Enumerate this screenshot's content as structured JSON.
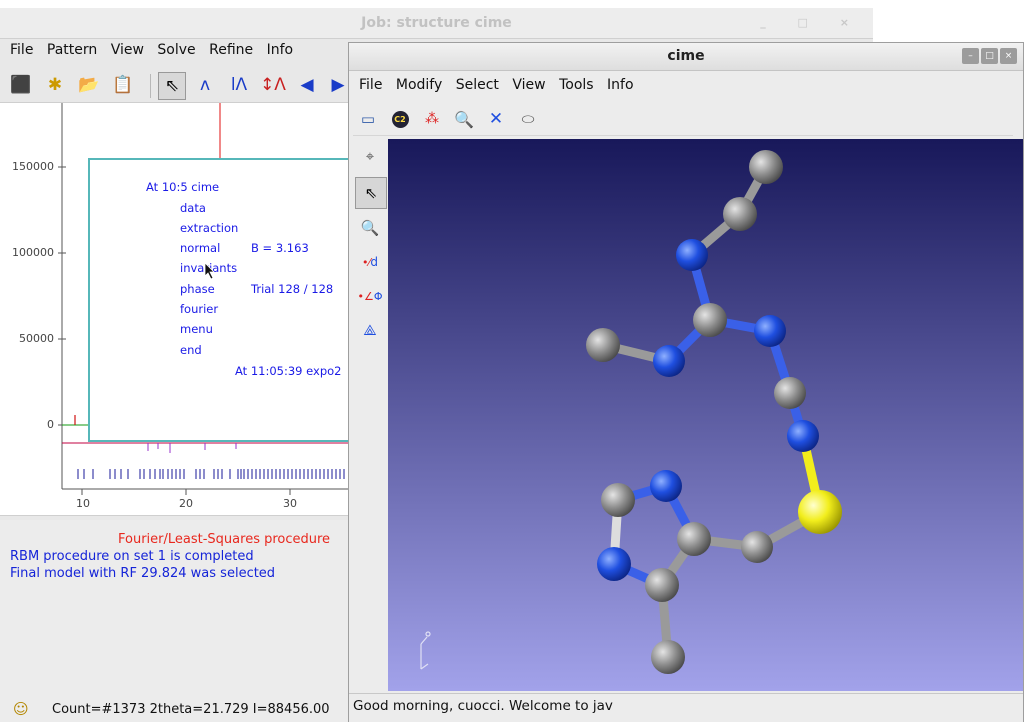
{
  "expo": {
    "title": "Job: structure cime",
    "window_controls": "_ □ ×",
    "menu": [
      "File",
      "Pattern",
      "View",
      "Solve",
      "Refine",
      "Info"
    ],
    "toolbar_icons": [
      "import-icon",
      "new-file-icon",
      "open-folder-icon",
      "notes-icon",
      "pointer-icon",
      "peak-zoom-icon",
      "peak-search-icon",
      "peak-add-icon",
      "arrow-left-icon",
      "arrow-right-icon"
    ],
    "plot": {
      "y_ticks": [
        "150000",
        "100000",
        "50000",
        "0"
      ],
      "x_ticks": [
        "10",
        "20",
        "30"
      ]
    },
    "log_window": {
      "lines": [
        {
          "text": "At 10:5 cime"
        },
        {
          "text": "data"
        },
        {
          "text": "extraction"
        },
        {
          "text": "normal",
          "extra": "B =   3.163"
        },
        {
          "text": "invariants"
        },
        {
          "text": "phase",
          "extra": "Trial  128 /  128"
        },
        {
          "text": "fourier"
        },
        {
          "text": "menu"
        },
        {
          "text": "end"
        }
      ],
      "footer": "At 11:05:39  expo2"
    },
    "messages": {
      "heading": "Fourier/Least-Squares procedure",
      "lines": [
        "RBM procedure on set 1 is completed",
        "Final model with RF 29.824 was selected"
      ]
    },
    "status": "Count=#1373 2theta=21.729 I=88456.00"
  },
  "cime": {
    "title": "cime",
    "menu": [
      "File",
      "Modify",
      "Select",
      "View",
      "Tools",
      "Info"
    ],
    "toolbar_icons": [
      "box-icon",
      "c2-symmetry-icon",
      "atoms-icon",
      "magnifier-icon",
      "center-arrows-icon",
      "eraser-icon"
    ],
    "left_tools": [
      "crosshair-icon",
      "pointer-icon",
      "zoom-icon",
      "distance-icon",
      "angle-icon",
      "torsion-icon"
    ],
    "left_tool_labels": {
      "distance": "d",
      "angle": "Φ"
    },
    "status": "Good morning, cuocci.  Welcome to jav",
    "colors": {
      "carbon": "#8c8c8c",
      "nitrogen": "#1f4fe0",
      "sulfur": "#f2ee1c",
      "bg_top": "#18185a",
      "bg_bottom": "#a0a0e8"
    }
  }
}
